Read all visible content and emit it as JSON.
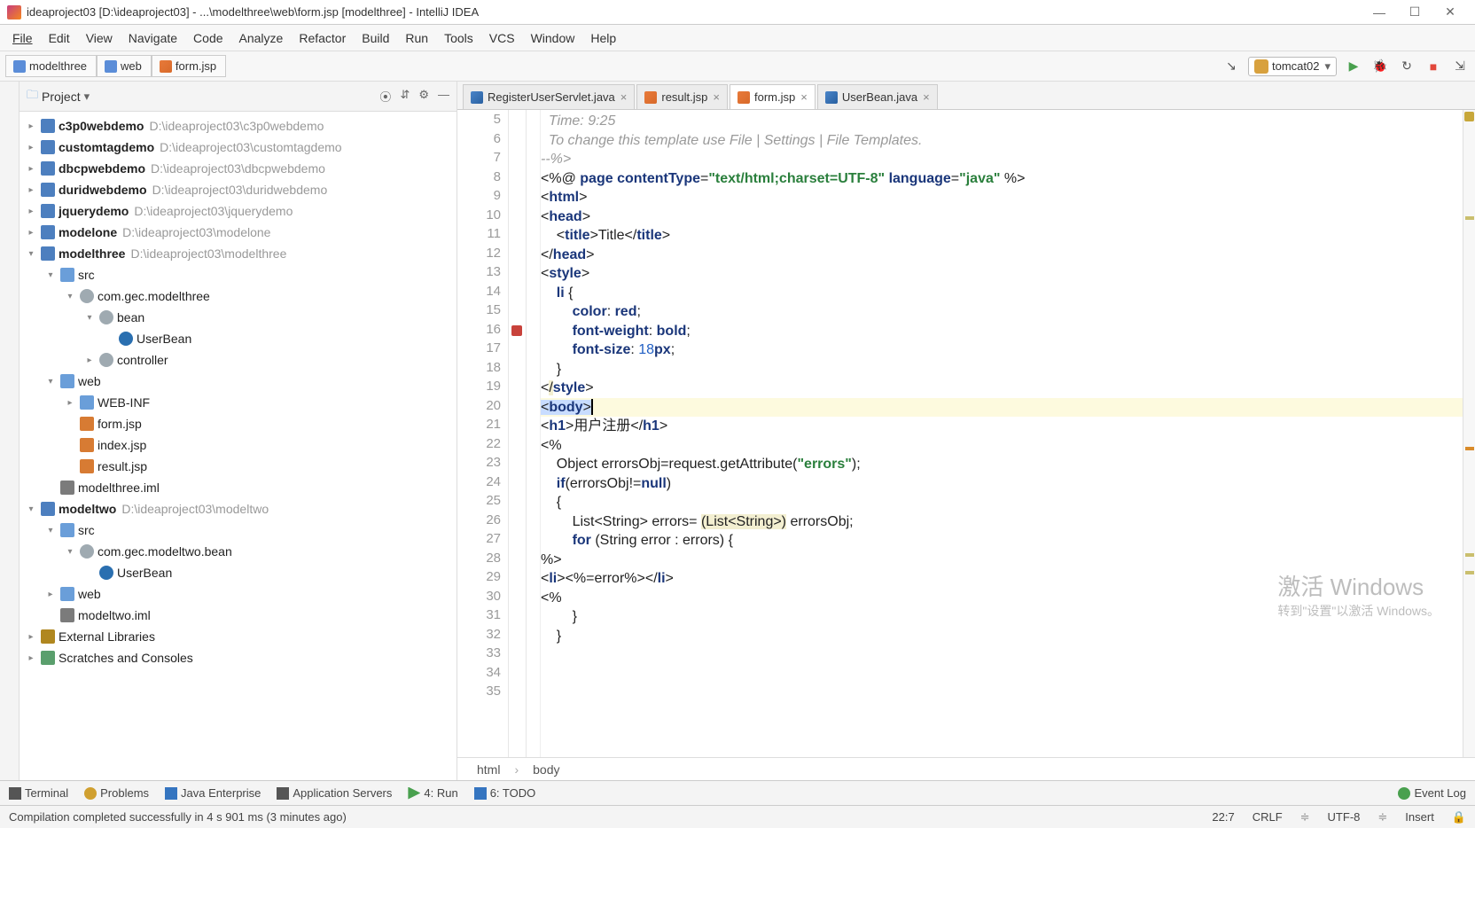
{
  "window": {
    "title": "ideaproject03 [D:\\ideaproject03] - ...\\modelthree\\web\\form.jsp [modelthree] - IntelliJ IDEA"
  },
  "menu": [
    "File",
    "Edit",
    "View",
    "Navigate",
    "Code",
    "Analyze",
    "Refactor",
    "Build",
    "Run",
    "Tools",
    "VCS",
    "Window",
    "Help"
  ],
  "breadcrumbs": [
    {
      "label": "modelthree",
      "type": "mod"
    },
    {
      "label": "web",
      "type": "mod"
    },
    {
      "label": "form.jsp",
      "type": "jsp"
    }
  ],
  "runConfig": "tomcat02",
  "project": {
    "header": "Project",
    "items": [
      {
        "indent": 0,
        "arrow": "right",
        "icon": "mod",
        "name": "c3p0webdemo",
        "bold": true,
        "path": "D:\\ideaproject03\\c3p0webdemo"
      },
      {
        "indent": 0,
        "arrow": "right",
        "icon": "mod",
        "name": "customtagdemo",
        "bold": true,
        "path": "D:\\ideaproject03\\customtagdemo"
      },
      {
        "indent": 0,
        "arrow": "right",
        "icon": "mod",
        "name": "dbcpwebdemo",
        "bold": true,
        "path": "D:\\ideaproject03\\dbcpwebdemo"
      },
      {
        "indent": 0,
        "arrow": "right",
        "icon": "mod",
        "name": "duridwebdemo",
        "bold": true,
        "path": "D:\\ideaproject03\\duridwebdemo"
      },
      {
        "indent": 0,
        "arrow": "right",
        "icon": "mod",
        "name": "jquerydemo",
        "bold": true,
        "path": "D:\\ideaproject03\\jquerydemo"
      },
      {
        "indent": 0,
        "arrow": "right",
        "icon": "mod",
        "name": "modelone",
        "bold": true,
        "path": "D:\\ideaproject03\\modelone"
      },
      {
        "indent": 0,
        "arrow": "down",
        "icon": "mod",
        "name": "modelthree",
        "bold": true,
        "path": "D:\\ideaproject03\\modelthree"
      },
      {
        "indent": 1,
        "arrow": "down",
        "icon": "folder",
        "name": "src"
      },
      {
        "indent": 2,
        "arrow": "down",
        "icon": "pkg",
        "name": "com.gec.modelthree"
      },
      {
        "indent": 3,
        "arrow": "down",
        "icon": "pkg",
        "name": "bean"
      },
      {
        "indent": 4,
        "arrow": "none",
        "icon": "cls",
        "name": "UserBean"
      },
      {
        "indent": 3,
        "arrow": "right",
        "icon": "pkg",
        "name": "controller"
      },
      {
        "indent": 1,
        "arrow": "down",
        "icon": "folder",
        "name": "web"
      },
      {
        "indent": 2,
        "arrow": "right",
        "icon": "folder",
        "name": "WEB-INF"
      },
      {
        "indent": 2,
        "arrow": "none",
        "icon": "file",
        "name": "form.jsp"
      },
      {
        "indent": 2,
        "arrow": "none",
        "icon": "file",
        "name": "index.jsp"
      },
      {
        "indent": 2,
        "arrow": "none",
        "icon": "file",
        "name": "result.jsp"
      },
      {
        "indent": 1,
        "arrow": "none",
        "icon": "iml",
        "name": "modelthree.iml"
      },
      {
        "indent": 0,
        "arrow": "down",
        "icon": "mod",
        "name": "modeltwo",
        "bold": true,
        "path": "D:\\ideaproject03\\modeltwo"
      },
      {
        "indent": 1,
        "arrow": "down",
        "icon": "folder",
        "name": "src"
      },
      {
        "indent": 2,
        "arrow": "down",
        "icon": "pkg",
        "name": "com.gec.modeltwo.bean"
      },
      {
        "indent": 3,
        "arrow": "none",
        "icon": "cls",
        "name": "UserBean"
      },
      {
        "indent": 1,
        "arrow": "right",
        "icon": "folder",
        "name": "web"
      },
      {
        "indent": 1,
        "arrow": "none",
        "icon": "iml",
        "name": "modeltwo.iml"
      },
      {
        "indent": 0,
        "arrow": "right",
        "icon": "lib",
        "name": "External Libraries"
      },
      {
        "indent": 0,
        "arrow": "right",
        "icon": "scratch",
        "name": "Scratches and Consoles"
      }
    ]
  },
  "tabs": [
    {
      "label": "RegisterUserServlet.java",
      "icon": "java",
      "active": false
    },
    {
      "label": "result.jsp",
      "icon": "jsp",
      "active": false
    },
    {
      "label": "form.jsp",
      "icon": "jsp",
      "active": true
    },
    {
      "label": "UserBean.java",
      "icon": "java",
      "active": false
    }
  ],
  "code": {
    "startLine": 5,
    "breakpointLine": 16,
    "currentLine": 22,
    "caretCol": 7,
    "lines": [
      {
        "raw": "  Time: 9:25",
        "cls": "cm"
      },
      {
        "raw": "  To change this template use File | Settings | File Templates.",
        "cls": "cm"
      },
      {
        "raw": "--%>",
        "cls": "cm"
      },
      {
        "html": "&lt;%@ <span class='kw'>page</span> <span class='attr'>contentType</span>=<span class='str'>\"text/html;charset=UTF-8\"</span> <span class='attr'>language</span>=<span class='str'>\"java\"</span> %&gt;"
      },
      {
        "html": "&lt;<span class='tag'>html</span>&gt;"
      },
      {
        "html": "&lt;<span class='tag'>head</span>&gt;"
      },
      {
        "html": "    &lt;<span class='tag'>title</span>&gt;Title&lt;/<span class='tag'>title</span>&gt;"
      },
      {
        "html": "&lt;/<span class='tag'>head</span>&gt;"
      },
      {
        "html": "&lt;<span class='tag'>style</span>&gt;"
      },
      {
        "raw": ""
      },
      {
        "html": "    <span class='tag'>li</span> {"
      },
      {
        "html": "        <span class='attr'>color</span>: <span class='kw'>red</span>;"
      },
      {
        "html": "        <span class='attr'>font-weight</span>: <span class='kw'>bold</span>;"
      },
      {
        "html": "        <span class='attr'>font-size</span>: <span class='num'>18</span><span class='kw'>px</span>;"
      },
      {
        "raw": "    }"
      },
      {
        "raw": ""
      },
      {
        "html": "&lt;<span class='warn-bg'>/</span><span class='tag'>style</span>&gt;"
      },
      {
        "html": "<span class='hl-line'><span class='sel'>&lt;<span class='tag'>body</span>&gt;</span><span class='cursor-caret'></span></span>"
      },
      {
        "html": "&lt;<span class='tag'>h1</span>&gt;用户注册&lt;/<span class='tag'>h1</span>&gt;"
      },
      {
        "html": "&lt;%"
      },
      {
        "html": "    Object errorsObj=request.getAttribute(<span class='str'>\"errors\"</span>);"
      },
      {
        "html": "    <span class='kw'>if</span>(errorsObj!=<span class='kw'>null</span>)"
      },
      {
        "raw": "    {"
      },
      {
        "html": "        List&lt;String&gt; errors= <span class='warn-bg'>(List&lt;String&gt;)</span> errorsObj;"
      },
      {
        "html": "        <span class='kw'>for</span> (String error : errors) {"
      },
      {
        "html": "%&gt;"
      },
      {
        "html": "&lt;<span class='tag'>li</span>&gt;&lt;%=error%&gt;&lt;/<span class='tag'>li</span>&gt;"
      },
      {
        "html": "&lt;%"
      },
      {
        "raw": ""
      },
      {
        "raw": "        }"
      },
      {
        "raw": "    }"
      }
    ]
  },
  "crumbBar": [
    "html",
    "body"
  ],
  "bottomTabs": {
    "terminal": "Terminal",
    "problems": "Problems",
    "javaee": "Java Enterprise",
    "appservers": "Application Servers",
    "run": "4: Run",
    "todo": "6: TODO",
    "eventlog": "Event Log"
  },
  "status": {
    "message": "Compilation completed successfully in 4 s 901 ms (3 minutes ago)",
    "pos": "22:7",
    "lineend": "CRLF",
    "encoding": "UTF-8",
    "insert": "Insert"
  },
  "watermark": {
    "title": "激活 Windows",
    "sub": "转到\"设置\"以激活 Windows。"
  }
}
